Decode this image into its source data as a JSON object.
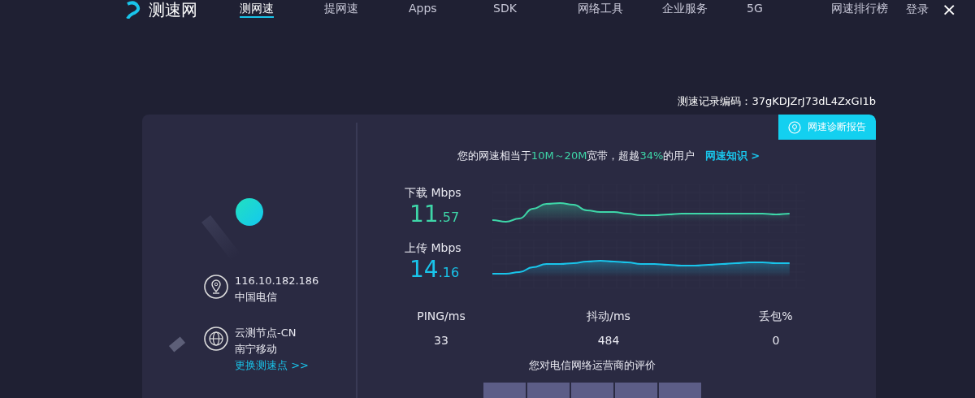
{
  "nav": {
    "logo": "测速网",
    "items": [
      {
        "label": "测网速",
        "selected": true
      },
      {
        "label": "提网速",
        "selected": false
      },
      {
        "label": "Apps",
        "selected": false
      },
      {
        "label": "SDK",
        "selected": false
      },
      {
        "label": "网络工具",
        "selected": false
      },
      {
        "label": "企业服务",
        "selected": false
      },
      {
        "label": "5G",
        "selected": false
      },
      {
        "label": "网速排行榜",
        "selected": false
      }
    ],
    "login": "登录",
    "close": "×"
  },
  "record": {
    "label": "测速记录编码：",
    "code": "37gKDJZrJ73dL4ZxGI1b"
  },
  "client": {
    "ip": "116.10.182.186",
    "isp": "中国电信"
  },
  "server": {
    "node": "云测节点-CN",
    "location": "南宁移动",
    "change_link": "更换测速点 >>"
  },
  "diagnose_button": "网速诊断报告",
  "summary": {
    "prefix": "您的网速相当于",
    "bandwidth": "10M～20M",
    "middle": "宽带，超越",
    "percent": "34%",
    "suffix": "的用户",
    "link": "网速知识 >"
  },
  "speeds": [
    {
      "kind": "download",
      "label": "下载 Mbps",
      "integer": "11",
      "decimal": ".57",
      "color": "#3ed6a8"
    },
    {
      "kind": "upload",
      "label": "上传 Mbps",
      "integer": "14",
      "decimal": ".16",
      "color": "#19c4ea"
    }
  ],
  "metrics": [
    {
      "label": "PING/ms",
      "value": "33"
    },
    {
      "label": "抖动/ms",
      "value": "484"
    },
    {
      "label": "丢包%",
      "value": "0"
    }
  ],
  "rating": {
    "title": "您对电信网络运营商的评价",
    "options": [
      {
        "selected": false
      },
      {
        "selected": false
      },
      {
        "selected": false
      },
      {
        "selected": false
      },
      {
        "selected": false
      }
    ]
  }
}
